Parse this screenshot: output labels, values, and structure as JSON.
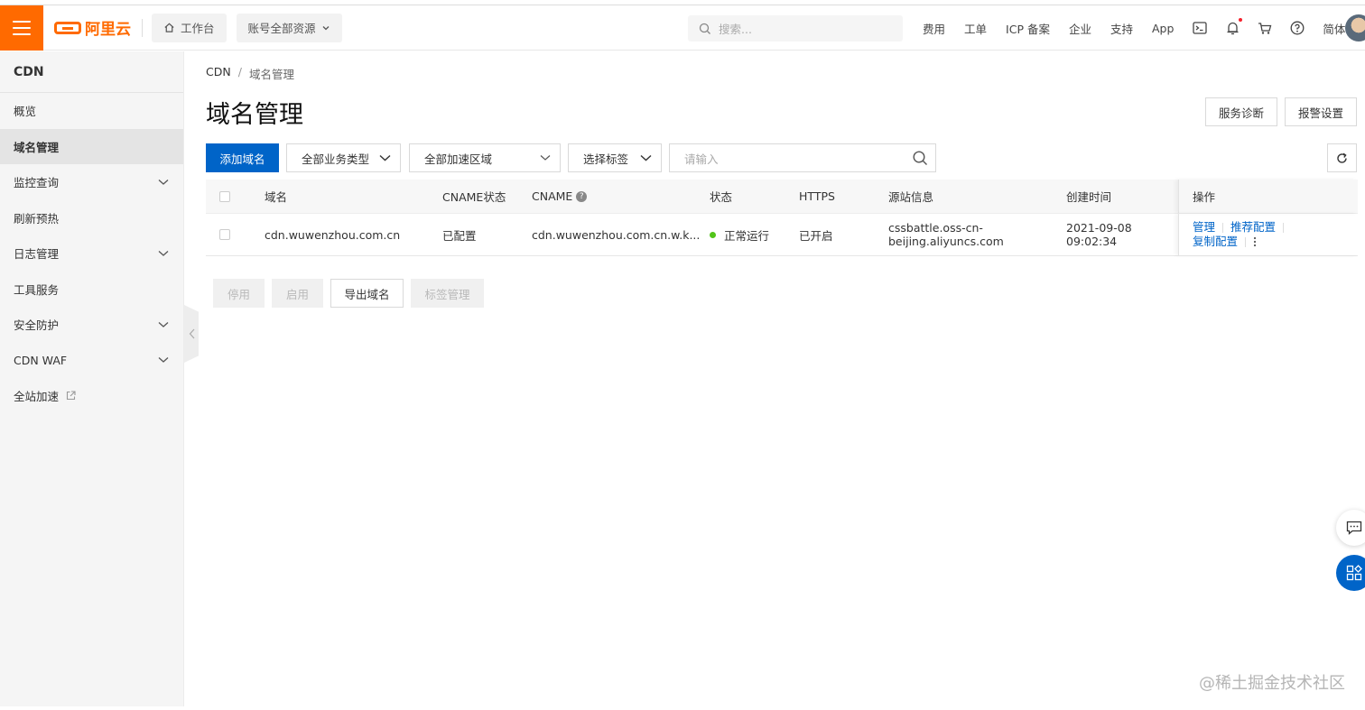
{
  "colors": {
    "brand": "#ff6a00",
    "primary": "#0064c8",
    "status_running": "#52c41a"
  },
  "topbar": {
    "logo_text": "阿里云",
    "workbench_label": "工作台",
    "resource_scope_label": "账号全部资源",
    "search_placeholder": "搜索...",
    "nav": {
      "fees": "费用",
      "tickets": "工单",
      "icp": "ICP 备案",
      "enterprise": "企业",
      "support": "支持",
      "app": "App",
      "lang": "简体"
    }
  },
  "sidebar": {
    "title": "CDN",
    "items": [
      {
        "label": "概览",
        "expandable": false
      },
      {
        "label": "域名管理",
        "expandable": false,
        "active": true
      },
      {
        "label": "监控查询",
        "expandable": true
      },
      {
        "label": "刷新预热",
        "expandable": false
      },
      {
        "label": "日志管理",
        "expandable": true
      },
      {
        "label": "工具服务",
        "expandable": false
      },
      {
        "label": "安全防护",
        "expandable": true
      },
      {
        "label": "CDN WAF",
        "expandable": true
      },
      {
        "label": "全站加速",
        "expandable": false,
        "external": true
      }
    ]
  },
  "breadcrumb": {
    "root": "CDN",
    "separator": "/",
    "current": "域名管理"
  },
  "page": {
    "title": "域名管理",
    "diagnose_button": "服务诊断",
    "alarm_button": "报警设置"
  },
  "toolbar": {
    "add_domain": "添加域名",
    "business_type": "全部业务类型",
    "region": "全部加速区域",
    "tag_select": "选择标签",
    "search_placeholder": "请输入"
  },
  "table": {
    "headers": {
      "domain": "域名",
      "cname_status": "CNAME状态",
      "cname": "CNAME",
      "status": "状态",
      "https": "HTTPS",
      "origin": "源站信息",
      "created": "创建时间",
      "ops": "操作"
    },
    "rows": [
      {
        "domain": "cdn.wuwenzhou.com.cn",
        "cname_status": "已配置",
        "cname": "cdn.wuwenzhou.com.cn.w.k...",
        "status": "正常运行",
        "https": "已开启",
        "origin_line1": "cssbattle.oss-cn-",
        "origin_line2": "beijing.aliyuncs.com",
        "created_date": "2021-09-08",
        "created_time": "09:02:34",
        "ops": {
          "manage": "管理",
          "recommend": "推荐配置",
          "copy": "复制配置"
        }
      }
    ]
  },
  "bulk_actions": {
    "disable": "停用",
    "enable": "启用",
    "export": "导出域名",
    "tags": "标签管理"
  },
  "watermark": "@稀土掘金技术社区"
}
